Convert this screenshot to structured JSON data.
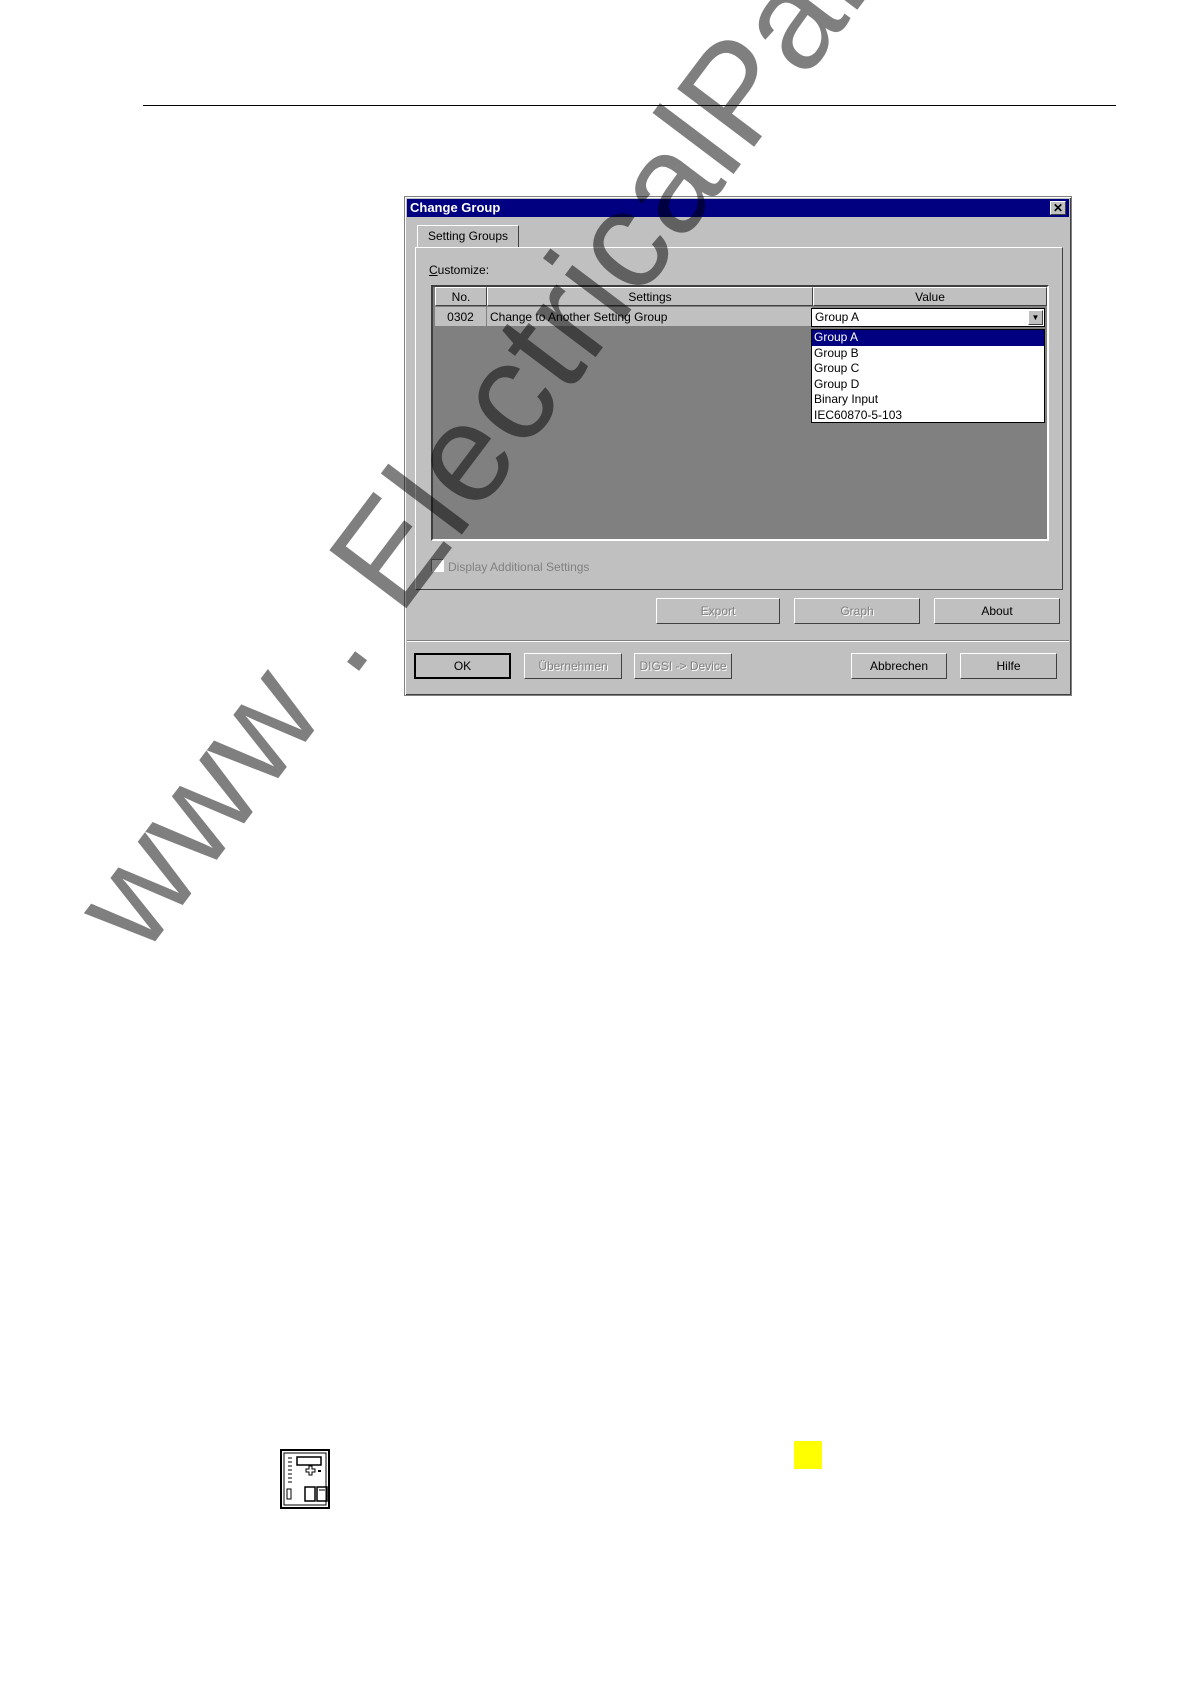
{
  "dialog": {
    "title": "Change Group",
    "close_glyph": "✕",
    "tab_label": "Setting Groups",
    "customize_label_first": "C",
    "customize_label_rest": "ustomize:",
    "columns": {
      "no": "No.",
      "settings": "Settings",
      "value": "Value"
    },
    "row": {
      "no": "0302",
      "setting": "Change to Another Setting Group",
      "value": "Group A"
    },
    "dropdown_options": [
      "Group A",
      "Group B",
      "Group C",
      "Group D",
      "Binary Input",
      "IEC60870-5-103"
    ],
    "checkbox_label": "Display Additional Settings",
    "checkbox_checked": false,
    "buttons": {
      "export": "Export",
      "graph": "Graph",
      "about": "About",
      "ok": "OK",
      "apply": "Übernehmen",
      "digsi": "DIGSI -> Device",
      "cancel": "Abbrechen",
      "help": "Hilfe"
    }
  },
  "watermark": "www . ElectricalPartManuals . com",
  "colors": {
    "titlebar": "#000080",
    "selection": "#000080",
    "marker": "#ffff00"
  },
  "icons": [
    "close-icon",
    "dropdown-arrow-icon",
    "device-front-panel-icon"
  ]
}
